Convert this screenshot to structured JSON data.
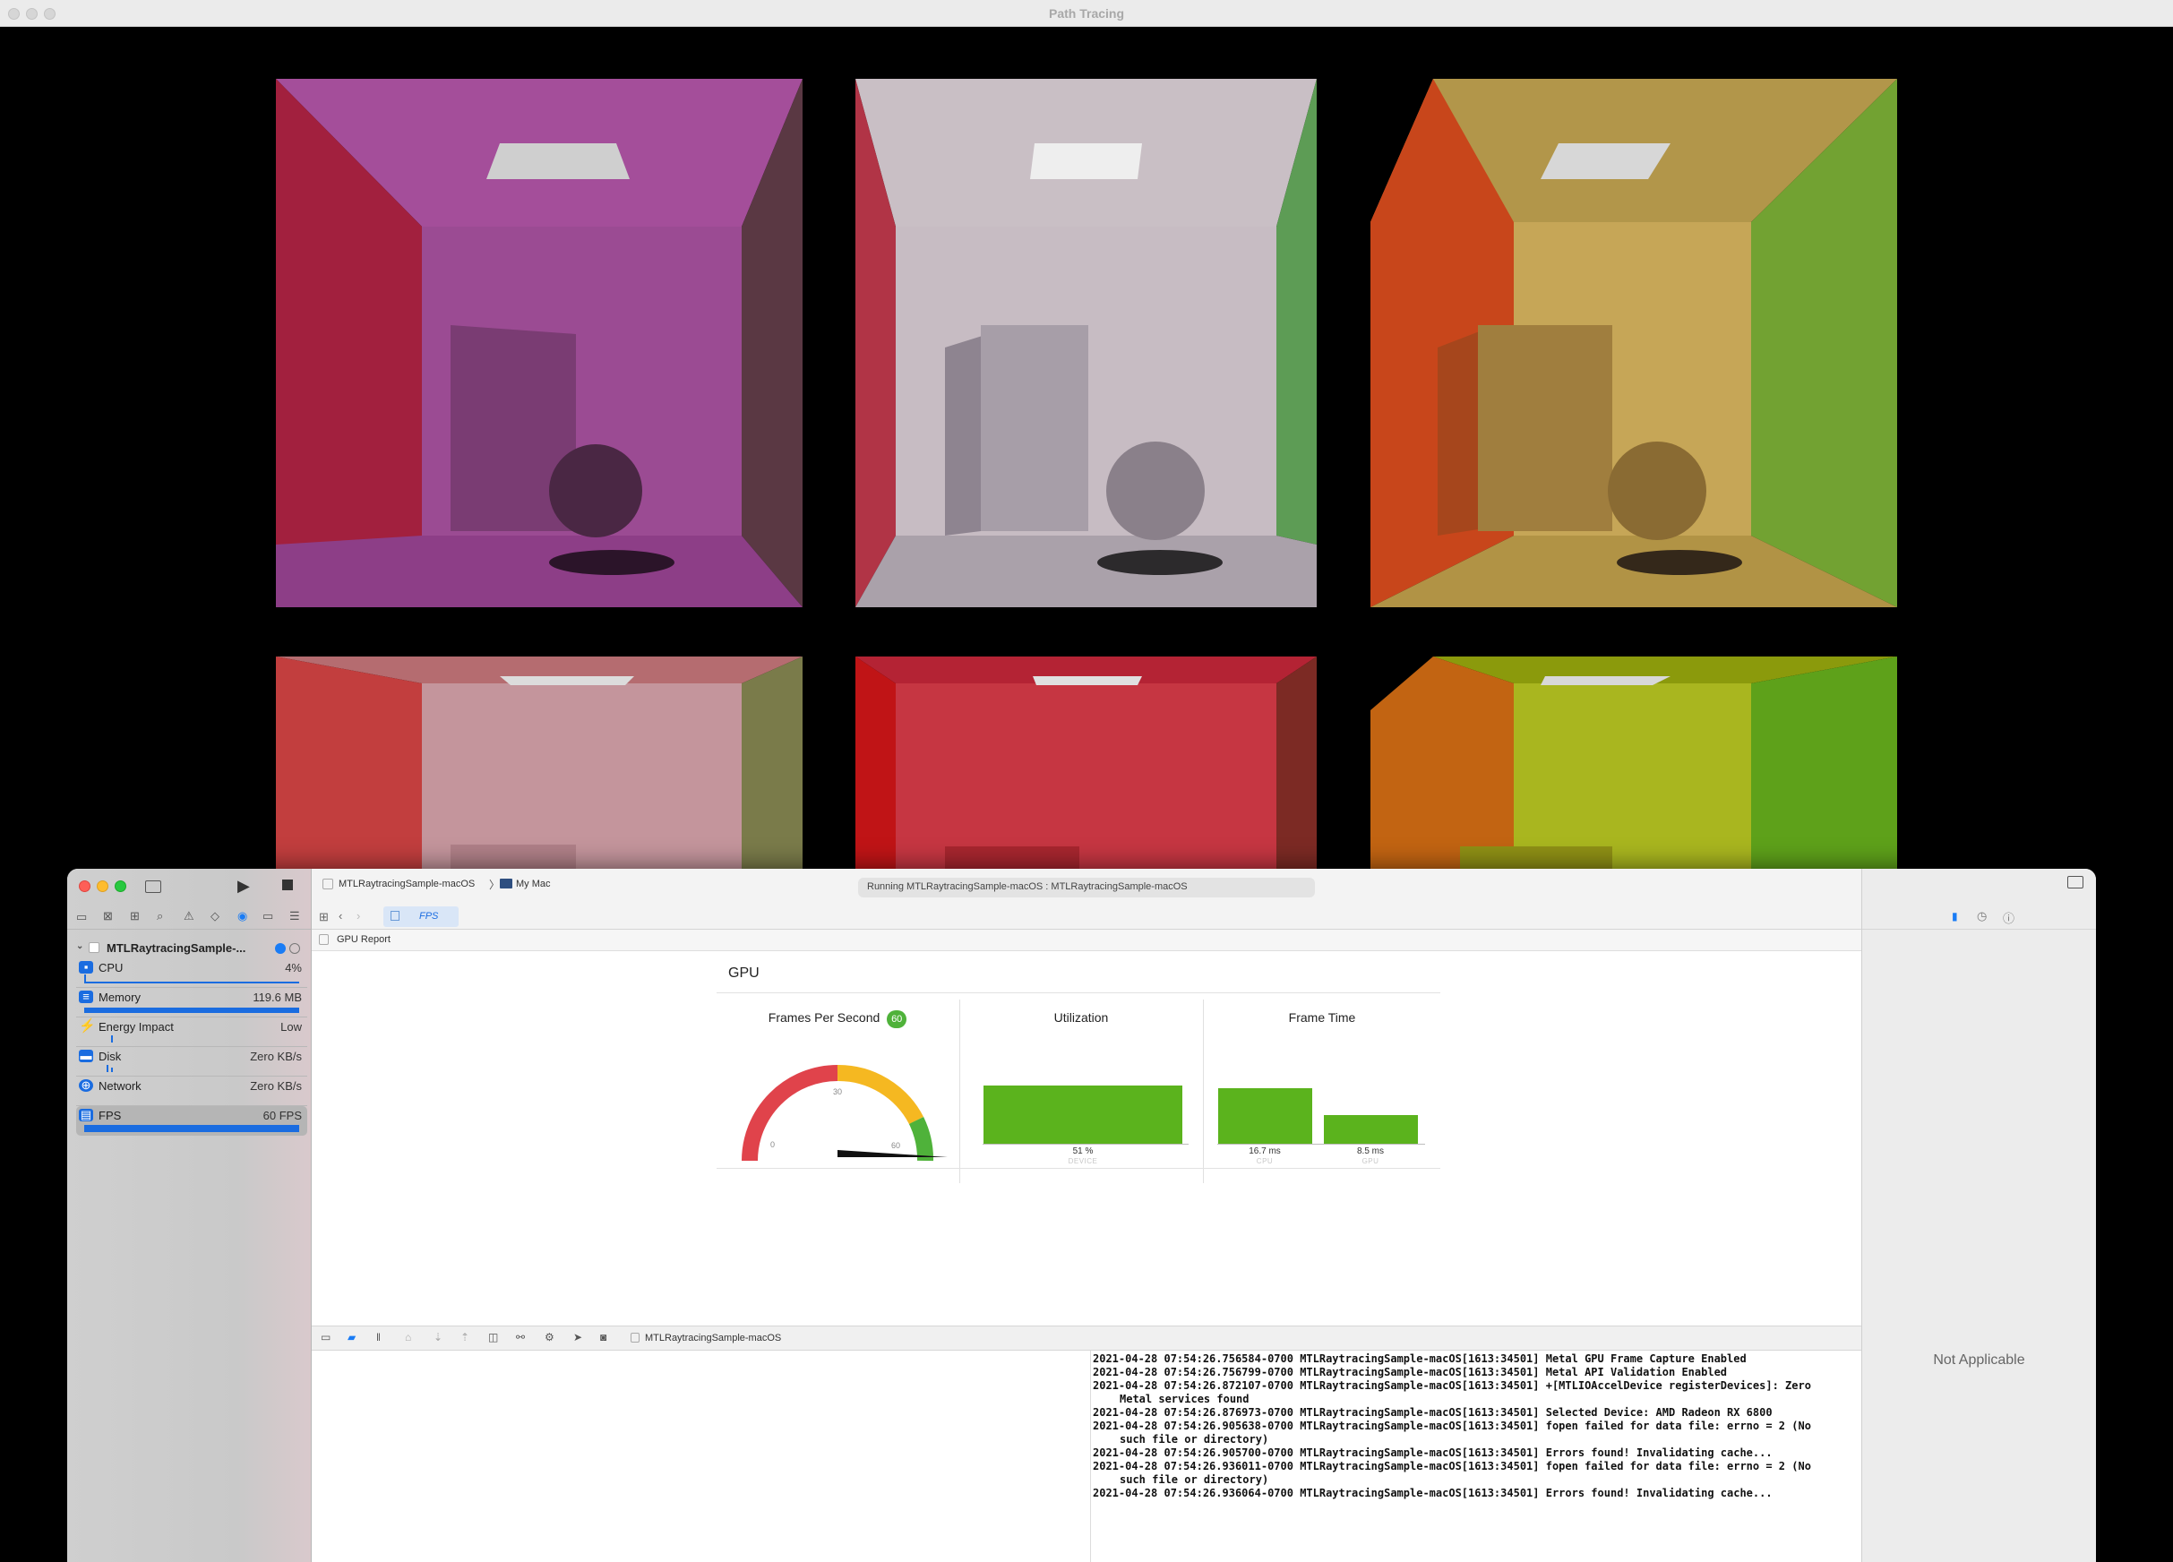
{
  "render_window": {
    "title": "Path Tracing"
  },
  "xcode": {
    "scheme": "MTLRaytracingSample-macOS",
    "destination": "My Mac",
    "status": "Running MTLRaytracingSample-macOS : MTLRaytracingSample-macOS",
    "editor_tab": "FPS",
    "report_breadcrumb": "GPU Report",
    "navigator": {
      "process_name": "MTLRaytracingSample-...",
      "gauges": [
        {
          "label": "CPU",
          "value": "4%",
          "icon": "cpu-icon"
        },
        {
          "label": "Memory",
          "value": "119.6 MB",
          "icon": "memory-icon"
        },
        {
          "label": "Energy Impact",
          "value": "Low",
          "icon": "energy-icon"
        },
        {
          "label": "Disk",
          "value": "Zero KB/s",
          "icon": "disk-icon"
        },
        {
          "label": "Network",
          "value": "Zero KB/s",
          "icon": "network-icon"
        },
        {
          "label": "FPS",
          "value": "60 FPS",
          "icon": "fps-icon"
        }
      ]
    },
    "gpu_report": {
      "title": "GPU",
      "fps": {
        "title": "Frames Per Second",
        "badge": "60",
        "value": 60,
        "tick_0": "0",
        "tick_30": "30",
        "tick_60": "60"
      },
      "utilization": {
        "title": "Utilization",
        "value_label": "51 %",
        "value": 51,
        "sub": "DEVICE"
      },
      "frame_time": {
        "title": "Frame Time",
        "cpu_label": "16.7 ms",
        "cpu_value": 16.7,
        "cpu_sub": "CPU",
        "gpu_label": "8.5 ms",
        "gpu_value": 8.5,
        "gpu_sub": "GPU"
      }
    },
    "debug_bar": {
      "target": "MTLRaytracingSample-macOS"
    },
    "console_lines": [
      "2021-04-28 07:54:26.756584-0700 MTLRaytracingSample-macOS[1613:34501] Metal GPU Frame Capture Enabled",
      "2021-04-28 07:54:26.756799-0700 MTLRaytracingSample-macOS[1613:34501] Metal API Validation Enabled",
      "2021-04-28 07:54:26.872107-0700 MTLRaytracingSample-macOS[1613:34501] +[MTLIOAccelDevice registerDevices]: Zero Metal services found",
      "2021-04-28 07:54:26.876973-0700 MTLRaytracingSample-macOS[1613:34501] Selected Device: AMD Radeon RX 6800",
      "2021-04-28 07:54:26.905638-0700 MTLRaytracingSample-macOS[1613:34501] fopen failed for data file: errno = 2 (No such file or directory)",
      "2021-04-28 07:54:26.905700-0700 MTLRaytracingSample-macOS[1613:34501] Errors found! Invalidating cache...",
      "2021-04-28 07:54:26.936011-0700 MTLRaytracingSample-macOS[1613:34501] fopen failed for data file: errno = 2 (No such file or directory)",
      "2021-04-28 07:54:26.936064-0700 MTLRaytracingSample-macOS[1613:34501] Errors found! Invalidating cache..."
    ],
    "inspector": {
      "empty_text": "Not Applicable"
    }
  },
  "colors": {
    "accent": "#1a7cf5",
    "fps_green": "#5bb31d",
    "gauge_red": "#e0434b",
    "gauge_yellow": "#f5b821"
  }
}
